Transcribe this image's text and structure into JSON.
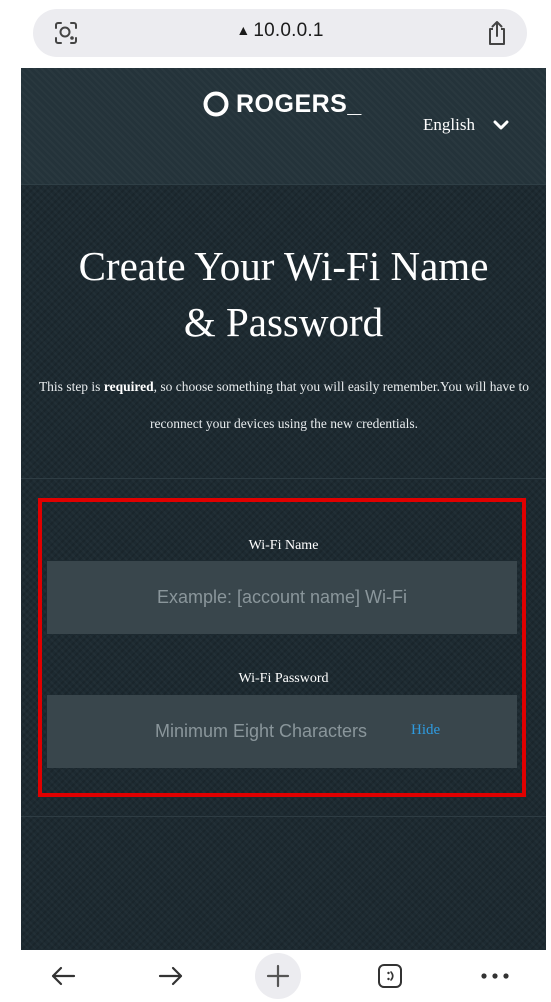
{
  "browser": {
    "url": "10.0.0.1",
    "lock_glyph": "▲"
  },
  "header": {
    "brand": "ROGERS_",
    "language": "English"
  },
  "main": {
    "title_line1": "Create Your Wi-Fi Name",
    "title_line2": "& Password",
    "desc_pre": "This step is ",
    "desc_bold": "required",
    "desc_post": ", so choose something that you will easily remember.You will have to reconnect your devices using the new credentials."
  },
  "form": {
    "wifi_name_label": "Wi-Fi Name",
    "wifi_name_placeholder": "Example: [account name] Wi-Fi",
    "wifi_password_label": "Wi-Fi Password",
    "wifi_password_placeholder": "Minimum Eight Characters",
    "hide_label": "Hide"
  },
  "colors": {
    "page_bg": "#1d2a31",
    "input_bg": "#39464c",
    "highlight": "#e00000",
    "link": "#2e9be0"
  },
  "icons": [
    "lens-icon",
    "share-icon",
    "rogers-logo-icon",
    "chevron-down-icon",
    "back-arrow-icon",
    "forward-arrow-icon",
    "new-tab-plus-icon",
    "tabs-icon",
    "more-icon"
  ]
}
